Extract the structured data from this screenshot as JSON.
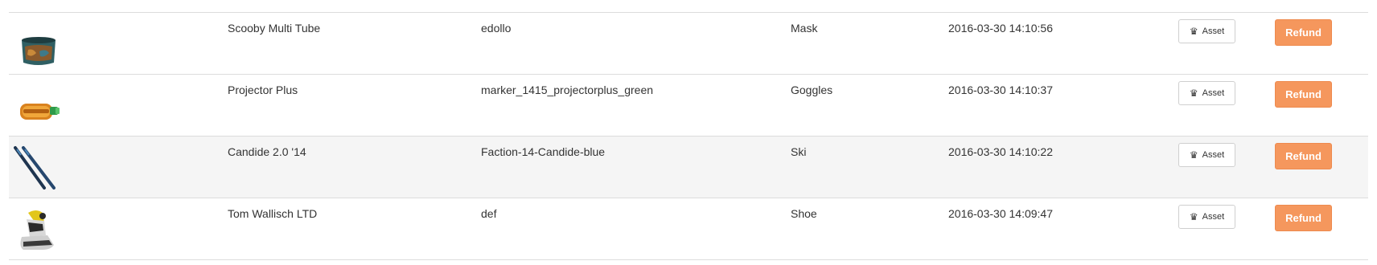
{
  "colors": {
    "refund": "#f5975d",
    "row_alt": "#f5f5f5",
    "border": "#dcdcdc"
  },
  "rows": [
    {
      "thumb_icon": "neck-tube-icon",
      "name": "Scooby Multi Tube",
      "sku": "edollo",
      "type": "Mask",
      "date": "2016-03-30 14:10:56",
      "asset_label": "Asset",
      "asset_icon": "chess-queen-icon",
      "refund_label": "Refund"
    },
    {
      "thumb_icon": "goggles-icon",
      "name": "Projector Plus",
      "sku": "marker_1415_projectorplus_green",
      "type": "Goggles",
      "date": "2016-03-30 14:10:37",
      "asset_label": "Asset",
      "asset_icon": "chess-queen-icon",
      "refund_label": "Refund"
    },
    {
      "thumb_icon": "skis-icon",
      "name": "Candide 2.0 '14",
      "sku": "Faction-14-Candide-blue",
      "type": "Ski",
      "date": "2016-03-30 14:10:22",
      "asset_label": "Asset",
      "asset_icon": "chess-queen-icon",
      "refund_label": "Refund"
    },
    {
      "thumb_icon": "ski-boot-icon",
      "name": "Tom Wallisch LTD",
      "sku": "def",
      "type": "Shoe",
      "date": "2016-03-30 14:09:47",
      "asset_label": "Asset",
      "asset_icon": "chess-queen-icon",
      "refund_label": "Refund"
    }
  ]
}
